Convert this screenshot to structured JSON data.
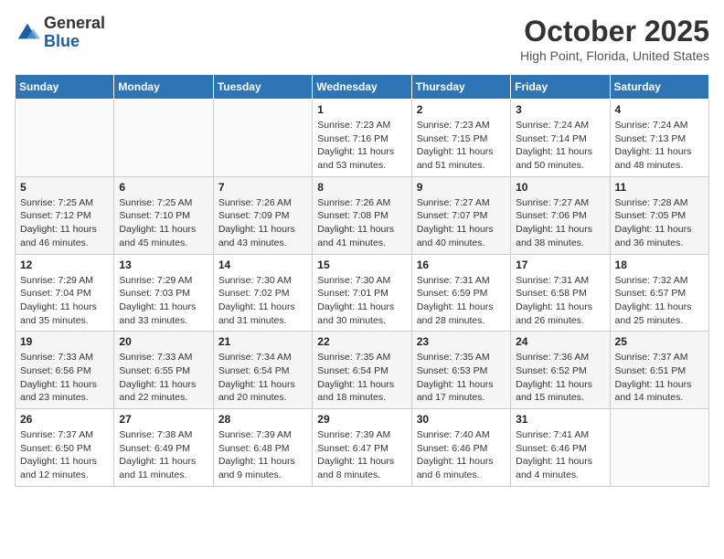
{
  "header": {
    "logo_general": "General",
    "logo_blue": "Blue",
    "month": "October 2025",
    "location": "High Point, Florida, United States"
  },
  "weekdays": [
    "Sunday",
    "Monday",
    "Tuesday",
    "Wednesday",
    "Thursday",
    "Friday",
    "Saturday"
  ],
  "weeks": [
    [
      {
        "day": "",
        "info": ""
      },
      {
        "day": "",
        "info": ""
      },
      {
        "day": "",
        "info": ""
      },
      {
        "day": "1",
        "info": "Sunrise: 7:23 AM\nSunset: 7:16 PM\nDaylight: 11 hours\nand 53 minutes."
      },
      {
        "day": "2",
        "info": "Sunrise: 7:23 AM\nSunset: 7:15 PM\nDaylight: 11 hours\nand 51 minutes."
      },
      {
        "day": "3",
        "info": "Sunrise: 7:24 AM\nSunset: 7:14 PM\nDaylight: 11 hours\nand 50 minutes."
      },
      {
        "day": "4",
        "info": "Sunrise: 7:24 AM\nSunset: 7:13 PM\nDaylight: 11 hours\nand 48 minutes."
      }
    ],
    [
      {
        "day": "5",
        "info": "Sunrise: 7:25 AM\nSunset: 7:12 PM\nDaylight: 11 hours\nand 46 minutes."
      },
      {
        "day": "6",
        "info": "Sunrise: 7:25 AM\nSunset: 7:10 PM\nDaylight: 11 hours\nand 45 minutes."
      },
      {
        "day": "7",
        "info": "Sunrise: 7:26 AM\nSunset: 7:09 PM\nDaylight: 11 hours\nand 43 minutes."
      },
      {
        "day": "8",
        "info": "Sunrise: 7:26 AM\nSunset: 7:08 PM\nDaylight: 11 hours\nand 41 minutes."
      },
      {
        "day": "9",
        "info": "Sunrise: 7:27 AM\nSunset: 7:07 PM\nDaylight: 11 hours\nand 40 minutes."
      },
      {
        "day": "10",
        "info": "Sunrise: 7:27 AM\nSunset: 7:06 PM\nDaylight: 11 hours\nand 38 minutes."
      },
      {
        "day": "11",
        "info": "Sunrise: 7:28 AM\nSunset: 7:05 PM\nDaylight: 11 hours\nand 36 minutes."
      }
    ],
    [
      {
        "day": "12",
        "info": "Sunrise: 7:29 AM\nSunset: 7:04 PM\nDaylight: 11 hours\nand 35 minutes."
      },
      {
        "day": "13",
        "info": "Sunrise: 7:29 AM\nSunset: 7:03 PM\nDaylight: 11 hours\nand 33 minutes."
      },
      {
        "day": "14",
        "info": "Sunrise: 7:30 AM\nSunset: 7:02 PM\nDaylight: 11 hours\nand 31 minutes."
      },
      {
        "day": "15",
        "info": "Sunrise: 7:30 AM\nSunset: 7:01 PM\nDaylight: 11 hours\nand 30 minutes."
      },
      {
        "day": "16",
        "info": "Sunrise: 7:31 AM\nSunset: 6:59 PM\nDaylight: 11 hours\nand 28 minutes."
      },
      {
        "day": "17",
        "info": "Sunrise: 7:31 AM\nSunset: 6:58 PM\nDaylight: 11 hours\nand 26 minutes."
      },
      {
        "day": "18",
        "info": "Sunrise: 7:32 AM\nSunset: 6:57 PM\nDaylight: 11 hours\nand 25 minutes."
      }
    ],
    [
      {
        "day": "19",
        "info": "Sunrise: 7:33 AM\nSunset: 6:56 PM\nDaylight: 11 hours\nand 23 minutes."
      },
      {
        "day": "20",
        "info": "Sunrise: 7:33 AM\nSunset: 6:55 PM\nDaylight: 11 hours\nand 22 minutes."
      },
      {
        "day": "21",
        "info": "Sunrise: 7:34 AM\nSunset: 6:54 PM\nDaylight: 11 hours\nand 20 minutes."
      },
      {
        "day": "22",
        "info": "Sunrise: 7:35 AM\nSunset: 6:54 PM\nDaylight: 11 hours\nand 18 minutes."
      },
      {
        "day": "23",
        "info": "Sunrise: 7:35 AM\nSunset: 6:53 PM\nDaylight: 11 hours\nand 17 minutes."
      },
      {
        "day": "24",
        "info": "Sunrise: 7:36 AM\nSunset: 6:52 PM\nDaylight: 11 hours\nand 15 minutes."
      },
      {
        "day": "25",
        "info": "Sunrise: 7:37 AM\nSunset: 6:51 PM\nDaylight: 11 hours\nand 14 minutes."
      }
    ],
    [
      {
        "day": "26",
        "info": "Sunrise: 7:37 AM\nSunset: 6:50 PM\nDaylight: 11 hours\nand 12 minutes."
      },
      {
        "day": "27",
        "info": "Sunrise: 7:38 AM\nSunset: 6:49 PM\nDaylight: 11 hours\nand 11 minutes."
      },
      {
        "day": "28",
        "info": "Sunrise: 7:39 AM\nSunset: 6:48 PM\nDaylight: 11 hours\nand 9 minutes."
      },
      {
        "day": "29",
        "info": "Sunrise: 7:39 AM\nSunset: 6:47 PM\nDaylight: 11 hours\nand 8 minutes."
      },
      {
        "day": "30",
        "info": "Sunrise: 7:40 AM\nSunset: 6:46 PM\nDaylight: 11 hours\nand 6 minutes."
      },
      {
        "day": "31",
        "info": "Sunrise: 7:41 AM\nSunset: 6:46 PM\nDaylight: 11 hours\nand 4 minutes."
      },
      {
        "day": "",
        "info": ""
      }
    ]
  ]
}
